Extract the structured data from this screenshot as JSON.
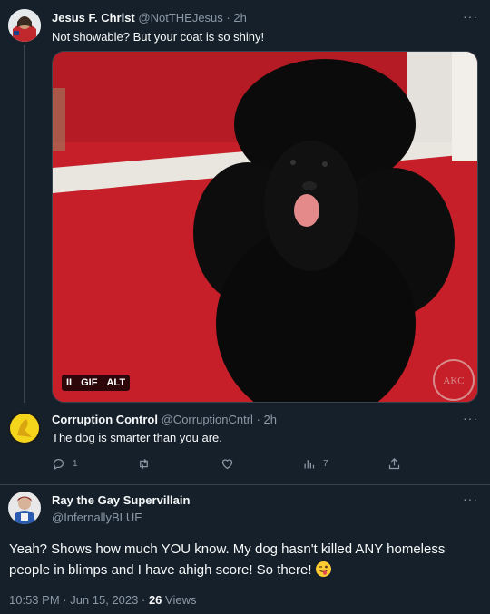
{
  "tweets": [
    {
      "name": "Jesus F. Christ",
      "handle": "@NotTHEJesus",
      "time": "2h",
      "text": "Not showable? But your coat is so shiny!",
      "more": "···",
      "media": {
        "badges": [
          "II",
          "GIF",
          "ALT"
        ],
        "watermark": "AKC"
      }
    },
    {
      "name": "Corruption Control",
      "handle": "@CorruptionCntrl",
      "time": "2h",
      "text": "The dog is smarter than you are.",
      "more": "···",
      "actions": {
        "replies": "1",
        "retweets": "",
        "likes": "",
        "views": "7"
      }
    }
  ],
  "main_tweet": {
    "name": "Ray the Gay Supervillain",
    "handle": "@InfernallyBLUE",
    "more": "···",
    "text": "Yeah? Shows how much YOU know. My dog hasn't killed ANY homeless people in blimps and I have ahigh score! So there!",
    "emoji": "winking-face-with-tongue",
    "timestamp": "10:53 PM · Jun 15, 2023 · ",
    "views_count": "26",
    "views_label": " Views"
  },
  "separator": " · ",
  "colors": {
    "background": "#15202b",
    "text": "#f7f9f9",
    "muted": "#8b98a5",
    "border": "#38444d"
  }
}
